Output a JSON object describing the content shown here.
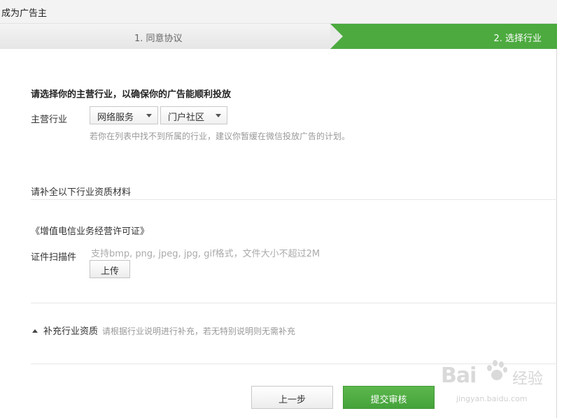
{
  "window": {
    "title": "成为广告主"
  },
  "steps": [
    {
      "label": "1. 同意协议",
      "active": false
    },
    {
      "label": "2. 选择行业",
      "active": true
    }
  ],
  "industry": {
    "heading": "请选择你的主营行业，以确保你的广告能顺利投放",
    "label": "主营行业",
    "primary_select": "网络服务",
    "secondary_select": "门户社区",
    "hint": "若你在列表中找不到所属的行业，建议你暂缓在微信投放广告的计划。"
  },
  "qualification": {
    "heading": "请补全以下行业资质材料",
    "document_title": "《增值电信业务经营许可证》",
    "scan_label": "证件扫描件",
    "scan_hint": "支持bmp, png, jpeg, jpg, gif格式，文件大小不超过2M",
    "upload_label": "上传"
  },
  "supplement": {
    "label": "补充行业资质",
    "hint": "请根据行业说明进行补充，若无特别说明则无需补充"
  },
  "footer": {
    "prev_label": "上一步",
    "submit_label": "提交审核"
  },
  "watermark": {
    "logo_text": "Bai",
    "logo_text_2": "经验",
    "url": "jingyan.baidu.com"
  },
  "colors": {
    "accent_green": "#4caa3f",
    "submit_green": "#4fae42",
    "hint_gray": "#999999"
  }
}
